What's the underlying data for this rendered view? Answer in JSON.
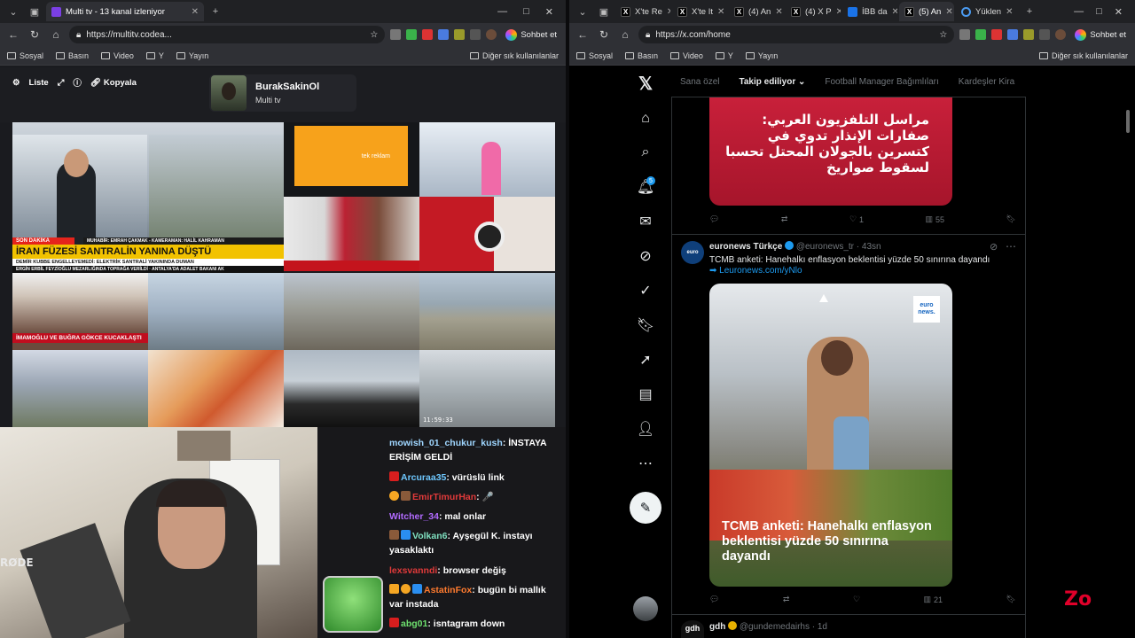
{
  "left": {
    "tab": {
      "title": "Multi tv - 13 kanal izleniyor"
    },
    "url": "https://multitv.codea...",
    "chat_btn": "Sohbet et",
    "bookmarks": [
      "Sosyal",
      "Basın",
      "Video",
      "Y",
      "Yayın"
    ],
    "bookmarks_other": "Diğer sık kullanılanlar",
    "controls": {
      "list": "Liste",
      "copy": "Kopyala"
    },
    "profile": {
      "name": "BurakSakinOl",
      "sub": "Multi tv"
    },
    "tiles": {
      "main_strap_top": "SON DAKİKA",
      "main_strap": "İRAN FÜZESİ SANTRALİN YANINA DÜŞTÜ",
      "main_strap2": "DEMİR KUBBE ENGELLEYEMEDİ: ELEKTRİK SANTRALİ YAKININDA DUMAN",
      "main_strap3": "ERGİN ERBİL FEYZİOĞLU MEZARLIĞINDA TOPRAĞA VERİLDİ · ANTALYA'DA ADALET BAKANI AK",
      "second_strap": "MUHABİR: EMRAH ÇAKMAK - KAMERAMAN: HALİL KAHRAMAN",
      "orange_text": "tek reklam",
      "red_caption": "İMAMOĞLU VE BUĞRA GÖKCE KUCAKLAŞTI",
      "time": "11:59:33"
    },
    "chat": [
      {
        "user": "mowish_01_chukur_kush",
        "color": "#9fd6ff",
        "text": "İNSTAYA ERİŞİM GELDİ"
      },
      {
        "user": "Arcuraa35",
        "color": "#6ec8ff",
        "text": "vürüslü link"
      },
      {
        "user": "EmirTimurHan",
        "color": "#e03a3a",
        "text": "🎤"
      },
      {
        "user": "Witcher_34",
        "color": "#b26bff",
        "text": "mal onlar"
      },
      {
        "user": "Volkan6",
        "color": "#7fe0c0",
        "text": "Ayşegül K. instayı yasaklaktı"
      },
      {
        "user": "lexsvanndi",
        "color": "#e03a3a",
        "text": "browser değiş"
      },
      {
        "user": "AstatinFox",
        "color": "#ff7b2f",
        "text": "bugün bi mallık var instada"
      },
      {
        "user": "abg01",
        "color": "#6ee06e",
        "text": "isntagram down"
      }
    ],
    "rode": "RØDE"
  },
  "right": {
    "tabs": [
      "X'te Re",
      "X'te It",
      "(4) An",
      "(4) X P",
      "İBB da",
      "(5) An",
      "Yüklen"
    ],
    "url": "https://x.com/home",
    "chat_btn": "Sohbet et",
    "bookmarks": [
      "Sosyal",
      "Basın",
      "Video",
      "Y",
      "Yayın"
    ],
    "bookmarks_other": "Diğer sık kullanılanlar",
    "notif_count": "5",
    "feed_tabs": [
      "Sana özel",
      "Takip ediliyor",
      "Football Manager Bağımlıları",
      "Kardeşler Kira"
    ],
    "arabic_text": "مراسل التلفزيون العربي: صفارات الإنذار تدوي في كتسرين بالجولان المحتل تحسبا لسقوط صواريخ",
    "post1_stats": {
      "likes": "1",
      "views": "55"
    },
    "post2": {
      "name": "euronews Türkçe",
      "handle": "@euronews_tr · 43sn",
      "text": "TCMB anketi: Hanehalkı enflasyon beklentisi yüzde 50 sınırına dayandı",
      "link": "Leuronews.com/yNlo",
      "image_title": "TCMB anketi: Hanehalkı enflasyon beklentisi yüzde 50 sınırına dayandı",
      "logo": "euro news.",
      "views": "21"
    },
    "post3": {
      "name": "gdh",
      "handle": "@gundemedairhs · 1d"
    },
    "watermark": "Zo"
  }
}
